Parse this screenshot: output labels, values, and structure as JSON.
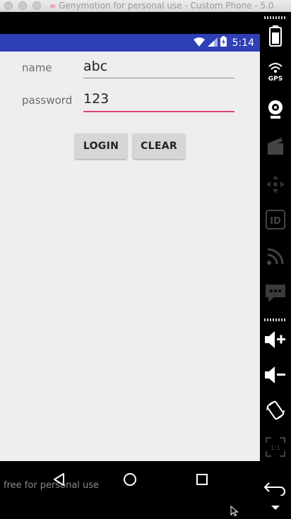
{
  "window": {
    "title": "Genymotion for personal use - Custom Phone - 5.0."
  },
  "status_bar": {
    "time": "5:14"
  },
  "form": {
    "name_label": "name",
    "name_value": "abc",
    "password_label": "password",
    "password_value": "123",
    "login_label": "LOGIN",
    "clear_label": "CLEAR"
  },
  "watermark": "free for personal use",
  "sidebar": {
    "tools": [
      "battery-icon",
      "gps-icon",
      "webcam-icon",
      "capture-icon",
      "dpad-icon",
      "id-icon",
      "network-icon",
      "message-icon",
      "volume-up-icon",
      "volume-down-icon",
      "rotate-icon",
      "pixel-perfect-icon",
      "back-icon",
      "menu-icon"
    ]
  },
  "colors": {
    "status_bar": "#2f3fb5",
    "accent": "#e0407e",
    "background": "#eeeeee"
  }
}
